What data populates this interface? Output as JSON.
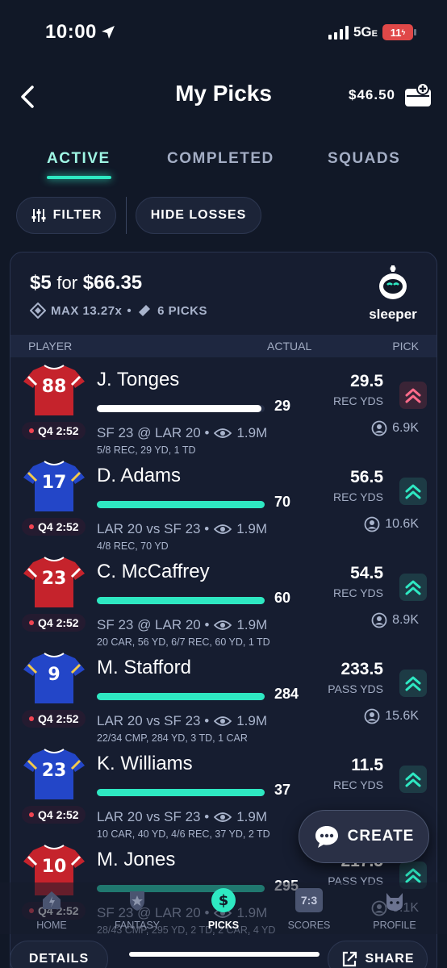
{
  "status_bar": {
    "time": "10:00",
    "network": "5G",
    "network_suffix": "E",
    "battery": "11"
  },
  "header": {
    "title": "My Picks",
    "balance": "$46.50"
  },
  "tabs": [
    {
      "label": "ACTIVE",
      "active": true
    },
    {
      "label": "COMPLETED",
      "active": false
    },
    {
      "label": "SQUADS",
      "active": false
    }
  ],
  "filters": {
    "filter_label": "FILTER",
    "hide_losses_label": "HIDE LOSSES"
  },
  "card": {
    "stake": "$5",
    "for_text": "for",
    "payout": "$66.35",
    "multiplier": "MAX 13.27x",
    "separator": "•",
    "picks_count": "6 PICKS",
    "brand": "sleeper",
    "columns": {
      "player": "PLAYER",
      "actual": "ACTUAL",
      "pick": "PICK"
    }
  },
  "rows": [
    {
      "number": "88",
      "team_color": "#c5232c",
      "clock": "Q4 2:52",
      "name": "J. Tonges",
      "actual": "29",
      "progress": 0.98,
      "bar_color": "#ffffff",
      "game": "SF 23 @ LAR 20 •",
      "views": "1.9M",
      "statline": "5/8 REC, 29 YD, 1 TD",
      "line": "29.5",
      "category": "REC YDS",
      "direction": "down",
      "picks": "6.9K"
    },
    {
      "number": "17",
      "team_color": "#2346c8",
      "clock": "Q4 2:52",
      "name": "D. Adams",
      "actual": "70",
      "progress": 1.0,
      "bar_color": "#2ee8c2",
      "game": "LAR 20 vs SF 23 •",
      "views": "1.9M",
      "statline": "4/8 REC, 70 YD",
      "line": "56.5",
      "category": "REC YDS",
      "direction": "up",
      "picks": "10.6K"
    },
    {
      "number": "23",
      "team_color": "#c5232c",
      "clock": "Q4 2:52",
      "name": "C. McCaffrey",
      "actual": "60",
      "progress": 1.0,
      "bar_color": "#2ee8c2",
      "game": "SF 23 @ LAR 20 •",
      "views": "1.9M",
      "statline": "20 CAR, 56 YD, 6/7 REC, 60 YD, 1 TD",
      "line": "54.5",
      "category": "REC YDS",
      "direction": "up",
      "picks": "8.9K"
    },
    {
      "number": "9",
      "team_color": "#2346c8",
      "clock": "Q4 2:52",
      "name": "M. Stafford",
      "actual": "284",
      "progress": 1.0,
      "bar_color": "#2ee8c2",
      "game": "LAR 20 vs SF 23 •",
      "views": "1.9M",
      "statline": "22/34 CMP, 284 YD, 3 TD, 1 CAR",
      "line": "233.5",
      "category": "PASS YDS",
      "direction": "up",
      "picks": "15.6K"
    },
    {
      "number": "23",
      "team_color": "#2346c8",
      "clock": "Q4 2:52",
      "name": "K. Williams",
      "actual": "37",
      "progress": 1.0,
      "bar_color": "#2ee8c2",
      "game": "LAR 20 vs SF 23 •",
      "views": "1.9M",
      "statline": "10 CAR, 40 YD, 4/6 REC, 37 YD, 2 TD",
      "line": "11.5",
      "category": "REC YDS",
      "direction": "up",
      "picks": ""
    },
    {
      "number": "10",
      "team_color": "#c5232c",
      "clock": "Q4 2:52",
      "name": "M. Jones",
      "actual": "295",
      "progress": 1.0,
      "bar_color": "#2ee8c2",
      "game": "SF 23 @ LAR 20 •",
      "views": "1.9M",
      "statline": "28/43 CMP, 295 YD, 2 TD, 2 CAR, 4 YD",
      "line": "217.5",
      "category": "PASS YDS",
      "direction": "up",
      "picks": "9.1K"
    }
  ],
  "create_button": "CREATE",
  "tabbar": [
    {
      "label": "HOME",
      "icon": "home-icon"
    },
    {
      "label": "FANTASY",
      "icon": "fantasy-icon"
    },
    {
      "label": "PICKS",
      "icon": "picks-icon",
      "active": true
    },
    {
      "label": "SCORES",
      "icon": "scores-icon",
      "badge": "7:3"
    },
    {
      "label": "PROFILE",
      "icon": "profile-icon"
    }
  ],
  "bottom_buttons": {
    "details": "DETAILS",
    "share": "SHARE"
  },
  "colors": {
    "accent": "#2ee8c2",
    "background": "#111827",
    "card": "#161d30",
    "live_red": "#f04452",
    "pick_down": "#ff6b8a"
  }
}
